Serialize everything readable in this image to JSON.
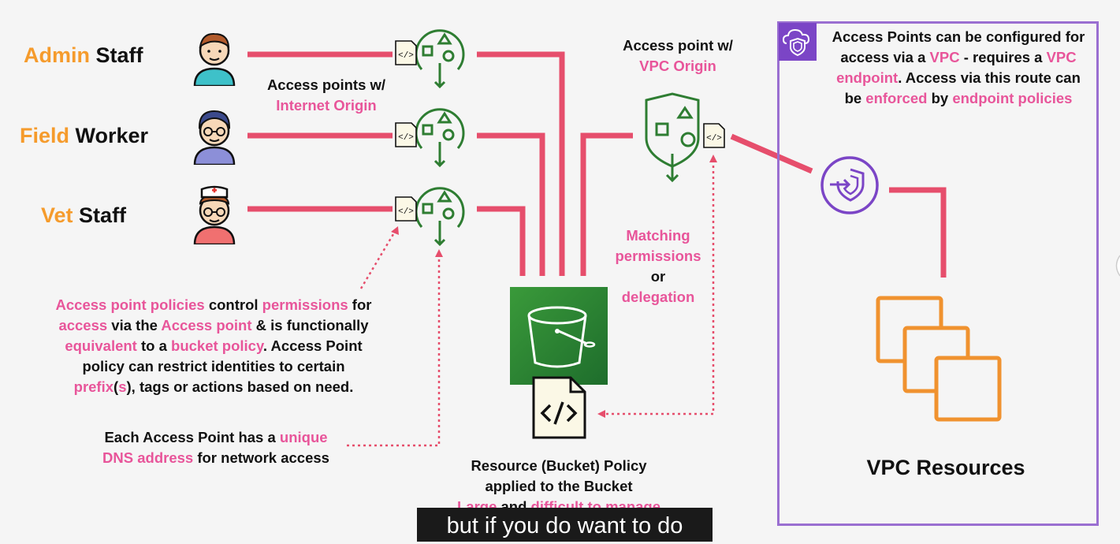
{
  "roles": [
    {
      "word1": "Admin",
      "word2": "Staff"
    },
    {
      "word1": "Field",
      "word2": "Worker"
    },
    {
      "word1": "Vet",
      "word2": "Staff"
    }
  ],
  "access_points_internet": {
    "line1": "Access points w/",
    "line2": "Internet Origin"
  },
  "access_point_vpc": {
    "line1": "Access point w/",
    "line2": "VPC Origin"
  },
  "vpc_note": {
    "l1": "Access Points can be configured for",
    "l2a": "access via a ",
    "l2b": "VPC",
    "l2c": " - requires a ",
    "l2d": "VPC",
    "l3a": "endpoint",
    "l3b": ". Access via this route can",
    "l4a": "be ",
    "l4b": "enforced",
    "l4c": " by ",
    "l4d": "endpoint policies"
  },
  "matching": {
    "l1": "Matching",
    "l2": "permissions",
    "l3": "or",
    "l4": "delegation"
  },
  "policy_note": {
    "l1a": "Access point policies",
    "l1b": " control ",
    "l1c": "permissions",
    "l1d": " for",
    "l2a": "access",
    "l2b": " via the ",
    "l2c": "Access point",
    "l2d": " & is functionally",
    "l3a": "equivalent",
    "l3b": " to a ",
    "l3c": "bucket policy",
    "l3d": ". Access Point",
    "l4": "policy can restrict identities to certain",
    "l5a": "prefix",
    "l5b": "(",
    "l5c": "s",
    "l5d": "), tags or actions based on need."
  },
  "dns_note": {
    "l1a": "Each Access Point has a ",
    "l1b": "unique",
    "l2a": "DNS address",
    "l2b": " for network access"
  },
  "bucket_policy": {
    "l1": "Resource (Bucket) Policy",
    "l2": "applied to the Bucket",
    "l3a": "Large",
    "l3b": " and ",
    "l3c": "difficult to manage"
  },
  "vpc_resources_label": "VPC Resources",
  "caption": "but if you do want to do",
  "colors": {
    "pink": "#e8559a",
    "orange": "#f59b2c",
    "connector": "#e64e6c",
    "purple": "#7b45c6",
    "green": "#2e7d32",
    "aws_orange": "#f0922f"
  },
  "icons": [
    "user-avatar",
    "access-point-icon",
    "policy-document-icon",
    "s3-bucket-icon",
    "vpc-endpoint-icon",
    "vpc-shield-icon",
    "ec2-instances-icon"
  ]
}
